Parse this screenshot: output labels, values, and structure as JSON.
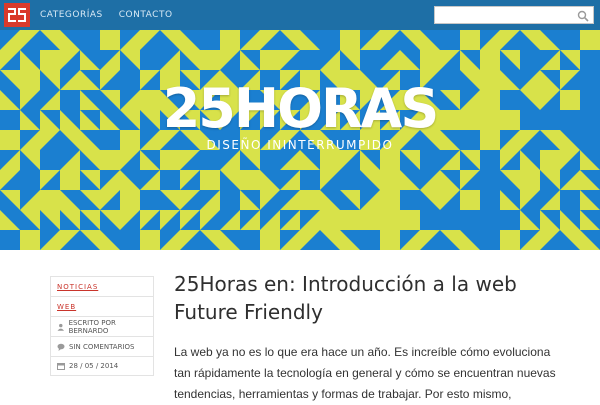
{
  "nav": {
    "logo_alt": "25",
    "items": [
      "CATEGORÍAS",
      "CONTACTO"
    ]
  },
  "search": {
    "placeholder": "",
    "value": ""
  },
  "hero": {
    "title": "25HORAS",
    "subtitle": "DISEÑO ININTERRUMPIDO",
    "colors": {
      "blue": "#1b7fd0",
      "yellow": "#d8e24a"
    }
  },
  "sidebar": {
    "tags": [
      "NOTICIAS",
      "WEB"
    ],
    "author": "ESCRITO POR BERNARDO",
    "comments": "SIN COMENTARIOS",
    "date": "28 / 05 / 2014"
  },
  "post": {
    "title": "25Horas en: Introducción a la web Future Friendly",
    "excerpt": "La web ya no es lo que era hace un año. Es increíble cómo evoluciona tan rápidamente la tecnología en general y cómo se encuentran nuevas tendencias, herramientas y formas de trabajar. Por esto mismo,"
  },
  "colors": {
    "nav_bg": "#1e6fa6",
    "accent": "#c9342b"
  }
}
